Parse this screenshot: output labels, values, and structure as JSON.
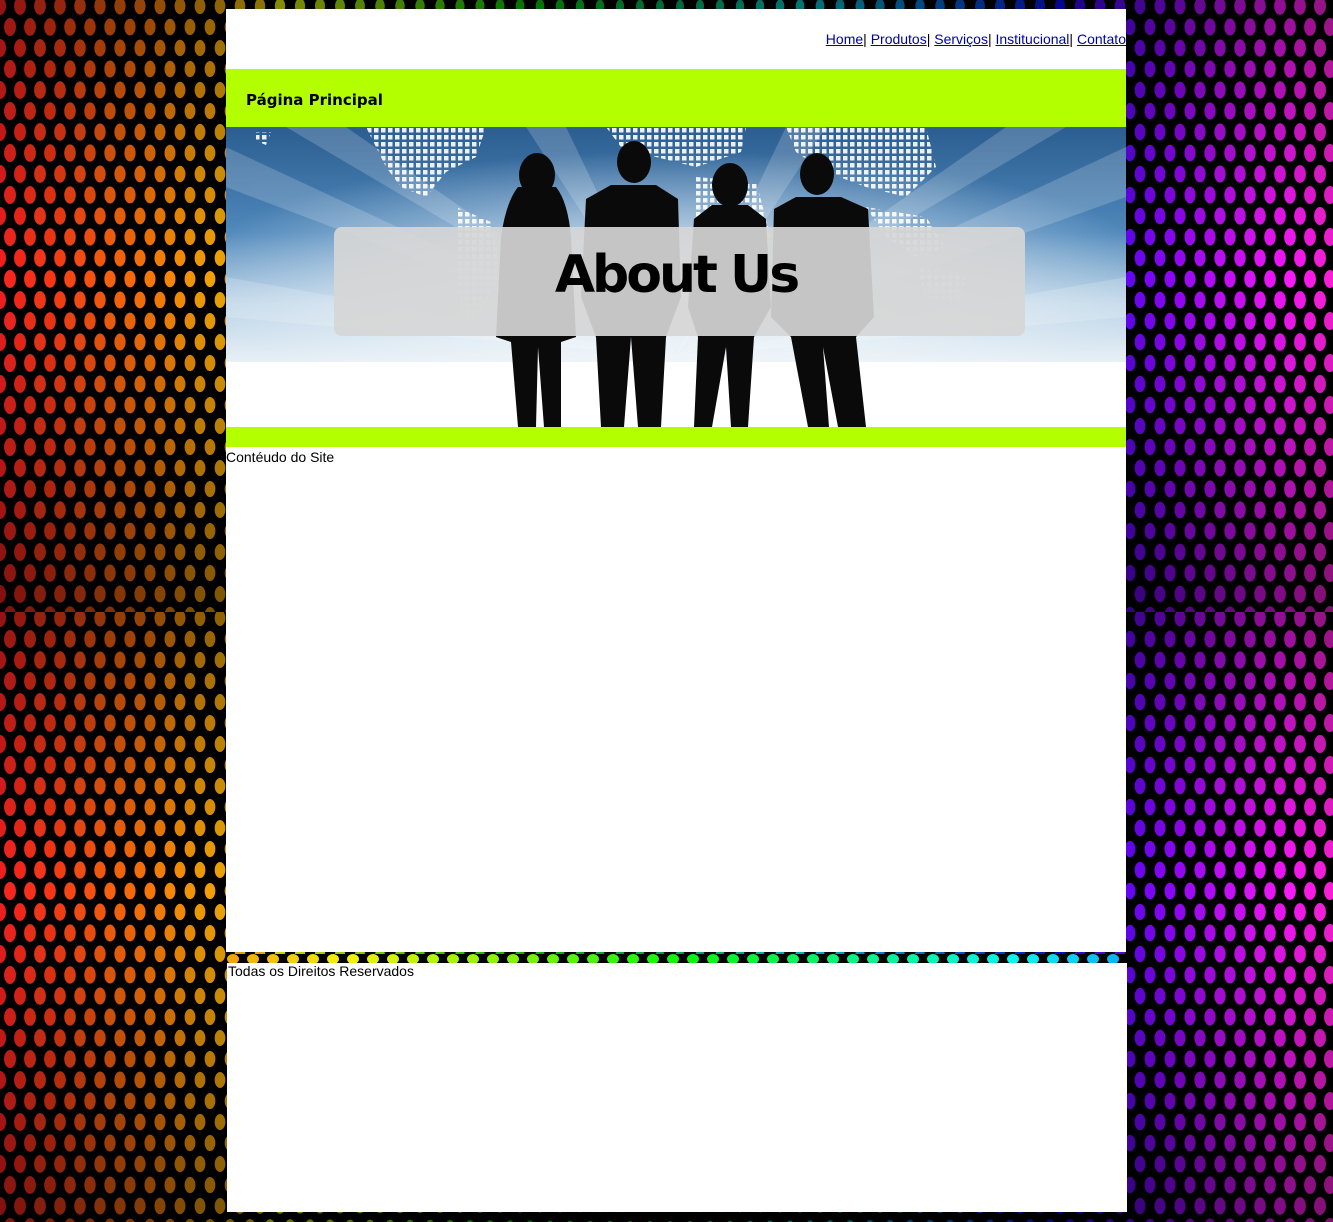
{
  "nav": {
    "items": [
      {
        "label": "Home"
      },
      {
        "label": "Produtos"
      },
      {
        "label": "Serviços"
      },
      {
        "label": "Institucional"
      },
      {
        "label": "Contato"
      }
    ],
    "separator": "|"
  },
  "header": {
    "title": "Página Principal"
  },
  "banner": {
    "title": "About Us"
  },
  "content": {
    "text": "Contéudo do Site"
  },
  "footer": {
    "text": "Todas os Direitos Reservados"
  },
  "colors": {
    "accent_green": "#b3ff00",
    "page_background": "#000000",
    "panel_background": "#ffffff",
    "link_color": "#0000aa"
  },
  "icons": {
    "background": "colorful-dots-pattern",
    "banner": "business-silhouettes-world-map"
  }
}
